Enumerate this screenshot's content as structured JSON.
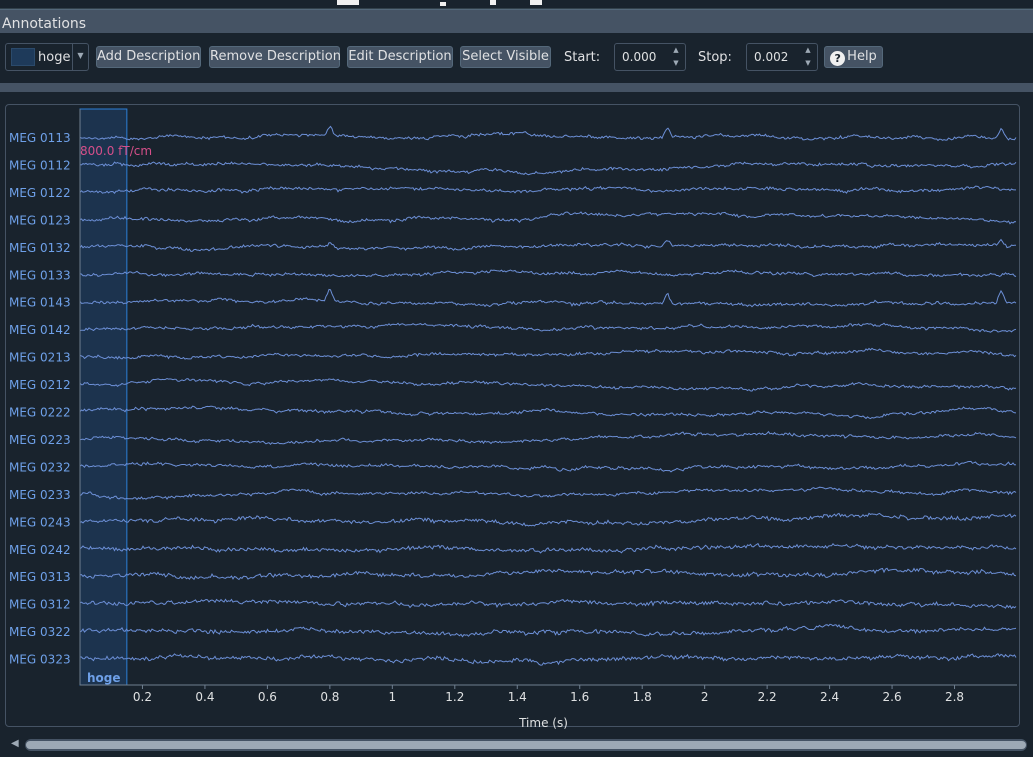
{
  "dock": {
    "title": "Annotations"
  },
  "toolbar": {
    "description_combo": {
      "value": "hoge",
      "swatch_color": "#1e3a5a"
    },
    "add_label": "Add Description",
    "remove_label": "Remove Description",
    "edit_label": "Edit Description",
    "select_visible_label": "Select Visible",
    "start_label": "Start:",
    "start_value": "0.000",
    "stop_label": "Stop:",
    "stop_value": "0.002",
    "help_label": "Help"
  },
  "colors": {
    "background": "#19232d",
    "trace": "#6c8fd6",
    "channel_label": "#6ea0e8",
    "scale_label": "#d64f8a",
    "annotation_fill": "#1e3a5a",
    "annotation_edge": "#2c7fd8"
  },
  "chart_data": {
    "type": "line",
    "xlabel": "Time (s)",
    "xlim": [
      0,
      3.0
    ],
    "x_ticks": [
      "0.2",
      "0.4",
      "0.6",
      "0.8",
      "1",
      "1.2",
      "1.4",
      "1.6",
      "1.8",
      "2",
      "2.2",
      "2.4",
      "2.6",
      "2.8"
    ],
    "channels": [
      "MEG 0113",
      "MEG 0112",
      "MEG 0122",
      "MEG 0123",
      "MEG 0132",
      "MEG 0133",
      "MEG 0143",
      "MEG 0142",
      "MEG 0213",
      "MEG 0212",
      "MEG 0222",
      "MEG 0223",
      "MEG 0232",
      "MEG 0233",
      "MEG 0243",
      "MEG 0242",
      "MEG 0313",
      "MEG 0312",
      "MEG 0322",
      "MEG 0323"
    ],
    "scale_label": "800.0 fT/cm",
    "spike_times": [
      0.8,
      1.88,
      2.95
    ],
    "spike_channels": [
      "MEG 0113",
      "MEG 0132",
      "MEG 0143"
    ],
    "annotations": [
      {
        "description": "hoge",
        "start": 0.0,
        "stop": 0.15
      }
    ]
  }
}
